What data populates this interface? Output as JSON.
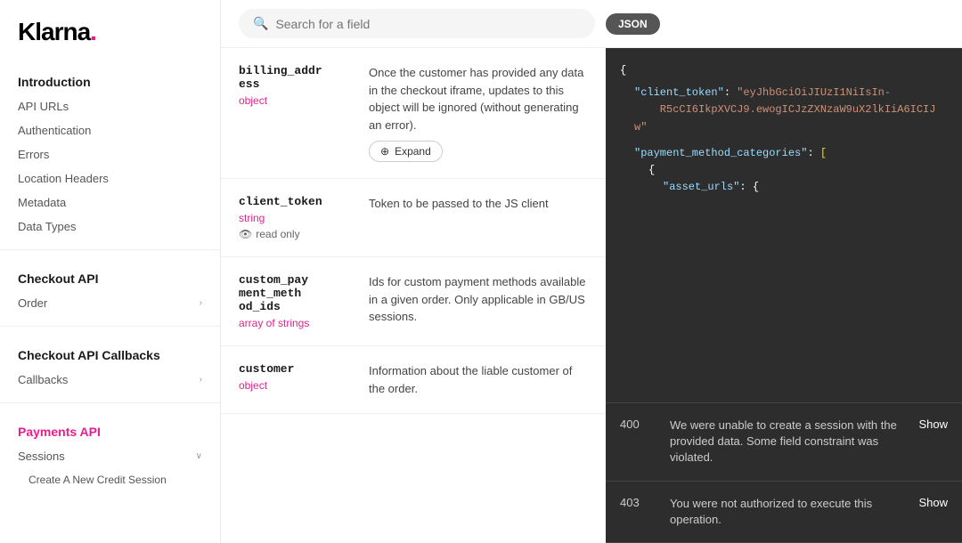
{
  "logo": {
    "text": "Klarna.",
    "dot_color": "#e91e8c"
  },
  "sidebar": {
    "sections": [
      {
        "title": "Introduction",
        "items": [
          {
            "label": "API URLs",
            "active": false,
            "chevron": false
          },
          {
            "label": "Authentication",
            "active": false,
            "chevron": false
          },
          {
            "label": "Errors",
            "active": false,
            "chevron": false
          },
          {
            "label": "Location Headers",
            "active": false,
            "chevron": false
          },
          {
            "label": "Metadata",
            "active": false,
            "chevron": false
          },
          {
            "label": "Data Types",
            "active": false,
            "chevron": false
          }
        ]
      },
      {
        "title": "Checkout API",
        "items": [
          {
            "label": "Order",
            "active": false,
            "chevron": true
          }
        ]
      },
      {
        "title": "Checkout API Callbacks",
        "items": [
          {
            "label": "Callbacks",
            "active": false,
            "chevron": true
          }
        ]
      },
      {
        "title": "Payments API",
        "items": [
          {
            "label": "Sessions",
            "active": false,
            "chevron": true
          },
          {
            "label": "Create A New Credit Session",
            "active": false,
            "chevron": false
          }
        ]
      }
    ]
  },
  "search": {
    "placeholder": "Search for a field"
  },
  "json_badge": "JSON",
  "fields": [
    {
      "name": "billing_addr\ness",
      "type": "object",
      "readonly": false,
      "description": "Once the customer has provided any data in the checkout iframe, updates to this object will be ignored (without generating an error).",
      "has_expand": true,
      "expand_label": "Expand"
    },
    {
      "name": "client_token",
      "type": "string",
      "readonly": true,
      "description": "Token to be passed to the JS client",
      "has_expand": false,
      "expand_label": ""
    },
    {
      "name": "custom_pay\nment_meth\nod_ids",
      "type": "array of strings",
      "readonly": false,
      "description": "Ids for custom payment methods available in a given order. Only applicable in GB/US sessions.",
      "has_expand": false,
      "expand_label": ""
    },
    {
      "name": "customer",
      "type": "object",
      "readonly": false,
      "description": "Information about the liable customer of the order.",
      "has_expand": false,
      "expand_label": ""
    }
  ],
  "json_panel": {
    "open_brace": "{",
    "client_token_key": "\"client_token\"",
    "client_token_value": "\"eyJhbGciOiJIUzI1NiIsIn-R5cCI6IkpXVCJ9.ewogICJzZXNzaW9uX2lkIiA6ICIJ w\"",
    "payment_categories_key": "\"payment_method_categories\"",
    "payment_categories_bracket": "[",
    "inner_open": "{",
    "asset_urls_key": "\"asset_urls\"",
    "asset_urls_open": "{"
  },
  "status_rows": [
    {
      "code": "400",
      "description": "We were unable to create a session with the provided data. Some field constraint was violated.",
      "show_label": "Show"
    },
    {
      "code": "403",
      "description": "You were not authorized to execute this operation.",
      "show_label": "Show"
    }
  ]
}
